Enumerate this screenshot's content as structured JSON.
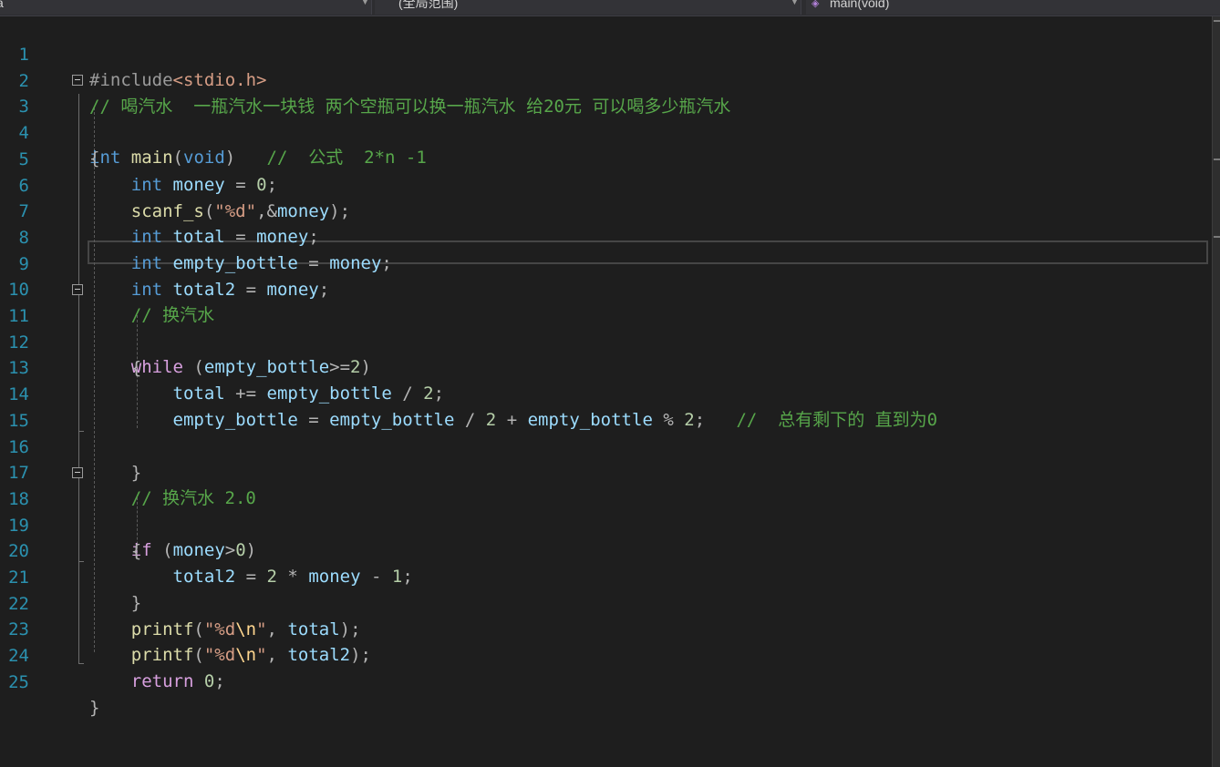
{
  "navbar": {
    "project_scope": "ā",
    "scope_label": "(全局范围)",
    "member_label": "main(void)",
    "member_icon": "cube-icon"
  },
  "editor": {
    "line_numbers": [
      "1",
      "2",
      "3",
      "4",
      "5",
      "6",
      "7",
      "8",
      "9",
      "10",
      "11",
      "12",
      "13",
      "14",
      "15",
      "16",
      "17",
      "18",
      "19",
      "20",
      "21",
      "22",
      "23",
      "24",
      "25"
    ],
    "lines": [
      "#include<stdio.h>",
      "// 喝汽水  一瓶汽水一块钱 两个空瓶可以换一瓶汽水 给20元 可以喝多少瓶汽水",
      "int main(void)   //  公式  2*n -1",
      "{",
      "    int money = 0;",
      "    scanf_s(\"%d\",&money);",
      "    int total = money;",
      "    int empty_bottle = money;",
      "    int total2 = money;",
      "    // 换汽水",
      "    while (empty_bottle>=2)",
      "    {",
      "        total += empty_bottle / 2;",
      "        empty_bottle = empty_bottle / 2 + empty_bottle % 2;   //  总有剩下的 直到为0",
      "",
      "    }",
      "    // 换汽水 2.0",
      "    if (money>0)",
      "    {",
      "        total2 = 2 * money - 1;",
      "    }",
      "    printf(\"%d\\n\", total);",
      "    printf(\"%d\\n\", total2);",
      "    return 0;",
      "}"
    ],
    "current_line": "9"
  },
  "colors": {
    "background": "#1e1e1e",
    "keyword": "#569cd6",
    "control": "#d8a0df",
    "function": "#dcdcaa",
    "variable": "#9cdcfe",
    "number": "#b5cea8",
    "string": "#d69d85",
    "comment": "#57a64a",
    "line_number": "#2b91af"
  }
}
